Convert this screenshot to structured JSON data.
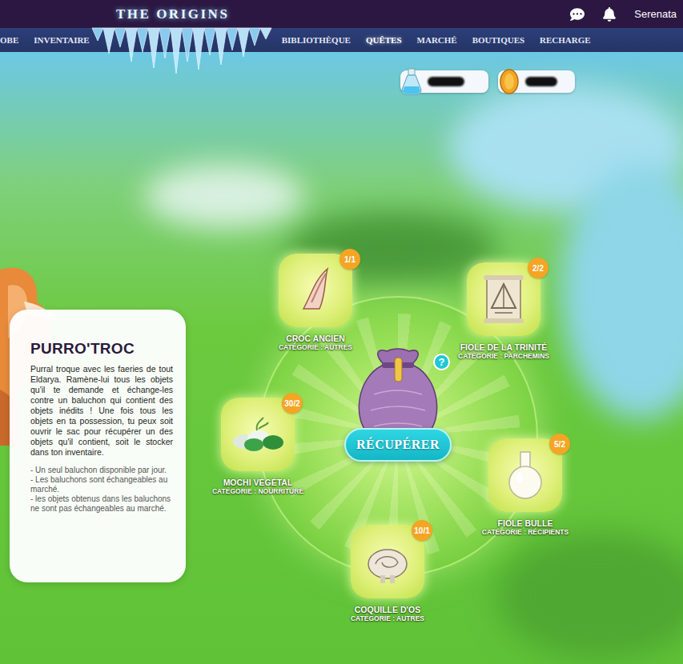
{
  "header": {
    "title": "THE ORIGINS",
    "user": "Serenata"
  },
  "nav": [
    {
      "label": "OBE",
      "selected": false
    },
    {
      "label": "INVENTAIRE",
      "selected": false
    },
    {
      "label": "BIBLIOTHÈQUE",
      "selected": false
    },
    {
      "label": "QUÊTES",
      "selected": true
    },
    {
      "label": "MARCHÉ",
      "selected": false
    },
    {
      "label": "BOUTIQUES",
      "selected": false
    },
    {
      "label": "RECHARGE",
      "selected": false
    }
  ],
  "quest": {
    "title": "PURRO'TROC",
    "description": "Purral troque avec les faeries de tout Eldarya. Ramène-lui tous les objets qu'il te demande et échange-les contre un baluchon qui contient des objets inédits ! Une fois tous les objets en ta possession, tu peux soit ouvrir le sac pour récupérer un des objets qu'il contient, soit le stocker dans ton inventaire.",
    "notes": [
      "- Un seul baluchon disponible par jour.",
      "- Les baluchons sont échangeables au marché.",
      "- les objets obtenus dans les baluchons ne sont pas échangeables au marché."
    ]
  },
  "items": [
    {
      "name": "CROC ANCIEN",
      "category": "CATÉGORIE : AUTRES",
      "count": "1/1",
      "kind": "fang"
    },
    {
      "name": "FIOLE DE LA TRINITÉ",
      "category": "CATÉGORIE : PARCHEMINS",
      "count": "2/2",
      "kind": "scroll"
    },
    {
      "name": "MOCHI VÉGÉTAL",
      "category": "CATÉGORIE : NOURRITURE",
      "count": "30/2",
      "kind": "mochi"
    },
    {
      "name": "FIOLE BULLE",
      "category": "CATÉGORIE : RÉCIPIENTS",
      "count": "5/2",
      "kind": "flask"
    },
    {
      "name": "COQUILLE D'OS",
      "category": "CATÉGORIE : AUTRES",
      "count": "10/1",
      "kind": "shell"
    }
  ],
  "help": "?",
  "action": {
    "label": "RÉCUPÉRER"
  }
}
